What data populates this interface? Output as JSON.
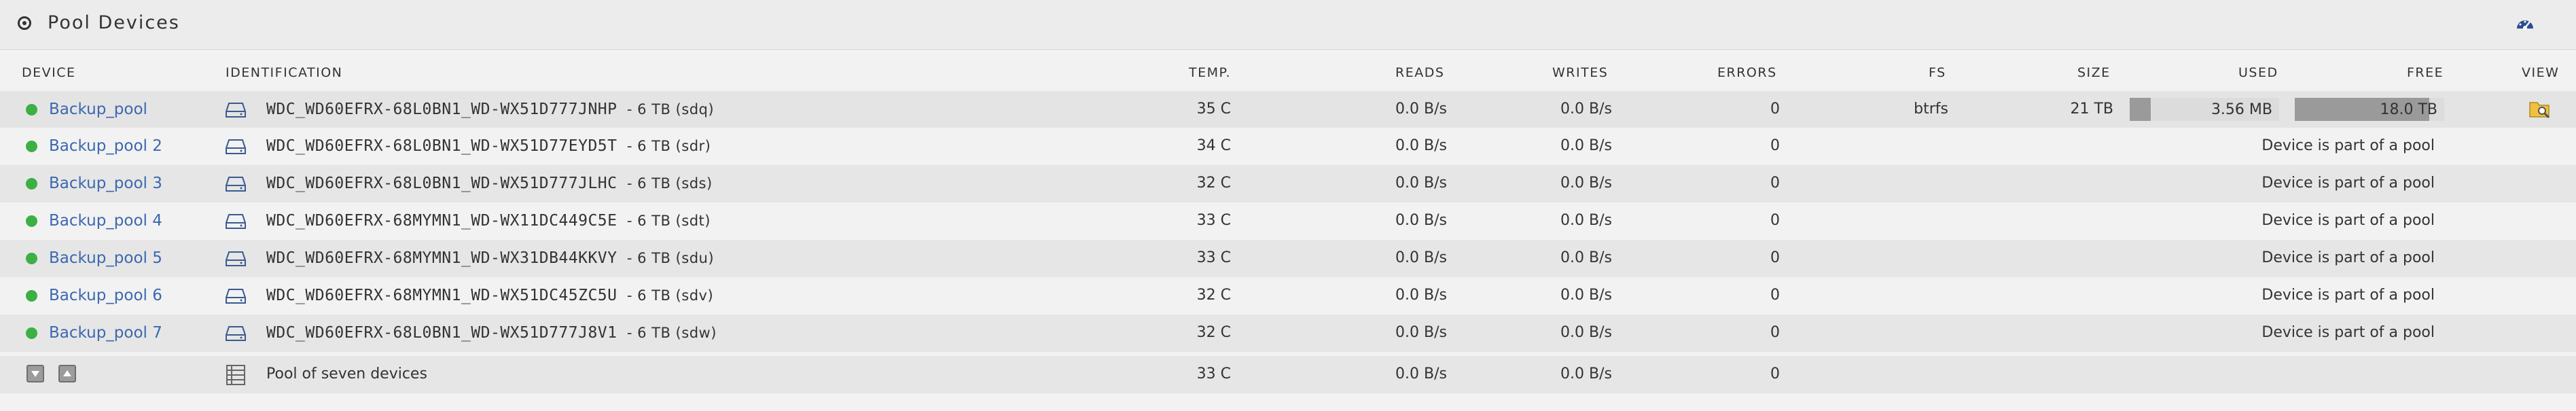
{
  "panel": {
    "title": "Pool Devices",
    "title_icon": "radio-target-icon",
    "settings_icon": "dashboard-gauge-icon"
  },
  "columns": {
    "device": "DEVICE",
    "identification": "IDENTIFICATION",
    "temp": "TEMP.",
    "reads": "READS",
    "writes": "WRITES",
    "errors": "ERRORS",
    "fs": "FS",
    "size": "SIZE",
    "used": "USED",
    "free": "FREE",
    "view": "VIEW"
  },
  "colors": {
    "status_ok": "#3cb043",
    "link": "#3b68b0",
    "bar_fill": "#9a9a9a",
    "bar_bg": "#dcdcdc"
  },
  "devices": [
    {
      "name": "Backup_pool",
      "id": "WDC_WD60EFRX-68L0BN1_WD-WX51D777JNHP",
      "size_label": "- 6 TB (sdq)",
      "temp": "35 C",
      "reads": "0.0 B/s",
      "writes": "0.0 B/s",
      "errors": "0",
      "fs": "btrfs",
      "size": "21 TB",
      "used": "3.56 MB",
      "used_fraction": 0.14,
      "free": "18.0 TB",
      "free_fraction": 0.9
    },
    {
      "name": "Backup_pool 2",
      "id": "WDC_WD60EFRX-68L0BN1_WD-WX51D77EYD5T",
      "size_label": "- 6 TB (sdr)",
      "temp": "34 C",
      "reads": "0.0 B/s",
      "writes": "0.0 B/s",
      "errors": "0",
      "note": "Device is part of a pool"
    },
    {
      "name": "Backup_pool 3",
      "id": "WDC_WD60EFRX-68L0BN1_WD-WX51D777JLHC",
      "size_label": "- 6 TB (sds)",
      "temp": "32 C",
      "reads": "0.0 B/s",
      "writes": "0.0 B/s",
      "errors": "0",
      "note": "Device is part of a pool"
    },
    {
      "name": "Backup_pool 4",
      "id": "WDC_WD60EFRX-68MYMN1_WD-WX11DC449C5E",
      "size_label": "- 6 TB (sdt)",
      "temp": "33 C",
      "reads": "0.0 B/s",
      "writes": "0.0 B/s",
      "errors": "0",
      "note": "Device is part of a pool"
    },
    {
      "name": "Backup_pool 5",
      "id": "WDC_WD60EFRX-68MYMN1_WD-WX31DB44KKVY",
      "size_label": "- 6 TB (sdu)",
      "temp": "33 C",
      "reads": "0.0 B/s",
      "writes": "0.0 B/s",
      "errors": "0",
      "note": "Device is part of a pool"
    },
    {
      "name": "Backup_pool 6",
      "id": "WDC_WD60EFRX-68MYMN1_WD-WX51DC45ZC5U",
      "size_label": "- 6 TB (sdv)",
      "temp": "32 C",
      "reads": "0.0 B/s",
      "writes": "0.0 B/s",
      "errors": "0",
      "note": "Device is part of a pool"
    },
    {
      "name": "Backup_pool 7",
      "id": "WDC_WD60EFRX-68L0BN1_WD-WX51D777J8V1",
      "size_label": "- 6 TB (sdw)",
      "temp": "32 C",
      "reads": "0.0 B/s",
      "writes": "0.0 B/s",
      "errors": "0",
      "note": "Device is part of a pool"
    }
  ],
  "summary": {
    "label": "Pool of seven devices",
    "temp": "33 C",
    "reads": "0.0 B/s",
    "writes": "0.0 B/s",
    "errors": "0",
    "down_icon": "arrow-down-icon",
    "up_icon": "arrow-up-icon",
    "list_icon": "list-icon"
  }
}
